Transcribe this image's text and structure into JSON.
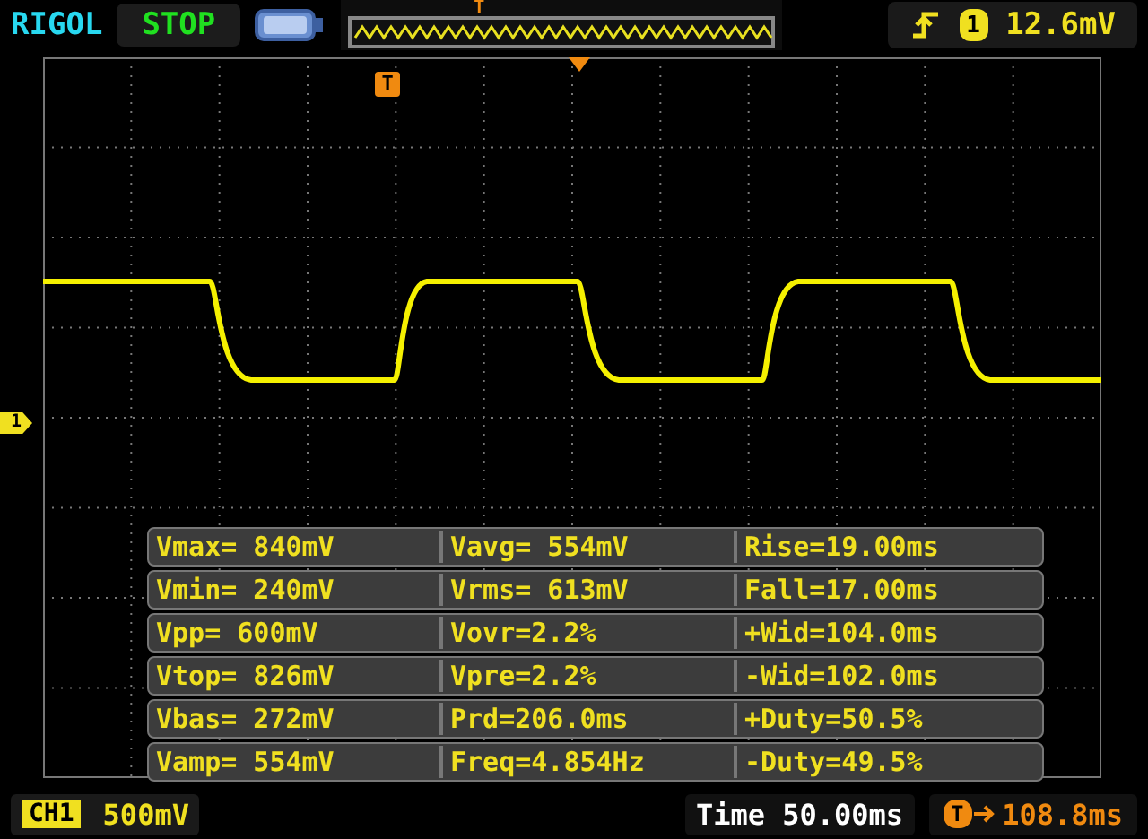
{
  "top_bar": {
    "brand": "RIGOL",
    "run_state": "STOP",
    "memory_trigger_mark": "T",
    "trigger": {
      "channel": "1",
      "level": "12.6mV"
    }
  },
  "screen": {
    "trigger_mark": "T",
    "channel_mark": "1"
  },
  "measurements": [
    [
      "Vmax= 840mV",
      "Vavg= 554mV",
      "Rise=19.00ms"
    ],
    [
      "Vmin= 240mV",
      "Vrms= 613mV",
      "Fall=17.00ms"
    ],
    [
      "Vpp= 600mV",
      "Vovr=2.2%",
      "+Wid=104.0ms"
    ],
    [
      "Vtop= 826mV",
      "Vpre=2.2%",
      "-Wid=102.0ms"
    ],
    [
      "Vbas= 272mV",
      "Prd=206.0ms",
      "+Duty=50.5%"
    ],
    [
      "Vamp= 554mV",
      "Freq=4.854Hz",
      "-Duty=49.5%"
    ]
  ],
  "status_bar": {
    "channel": "CH1",
    "scale": "500mV",
    "timebase": "Time 50.00ms",
    "trigger_offset_mark": "T",
    "trigger_offset": "108.8ms"
  }
}
